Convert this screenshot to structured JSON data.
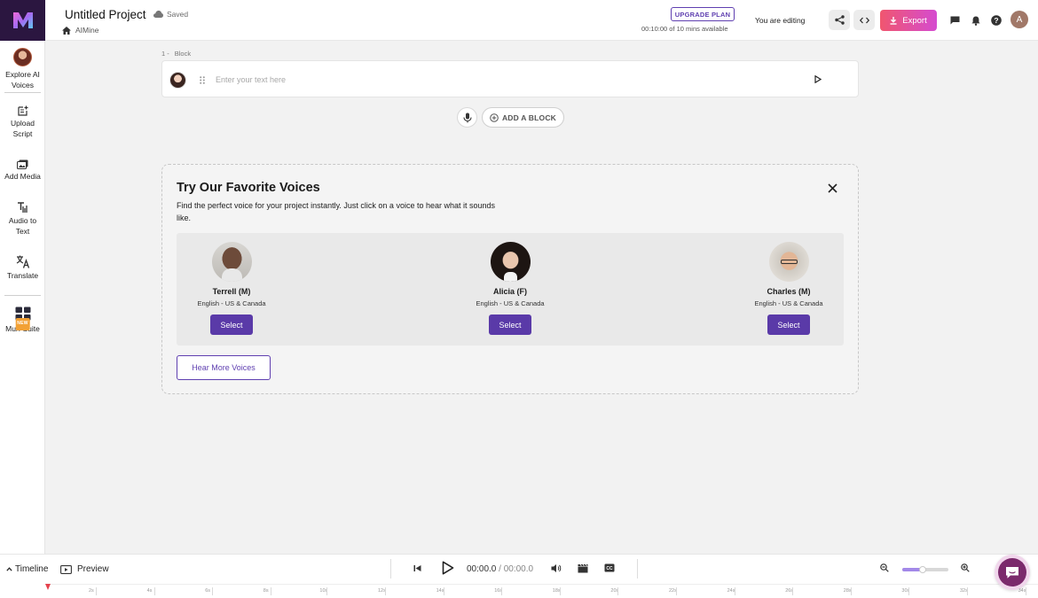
{
  "topbar": {
    "project_title": "Untitled Project",
    "saved_label": "Saved",
    "breadcrumb": "AIMine",
    "upgrade_label": "UPGRADE PLAN",
    "usage_text": "00:10:00 of 10 mins available",
    "editing_text": "You are editing",
    "export_label": "Export",
    "user_initial": "A"
  },
  "sidebar": {
    "items": [
      {
        "label_line1": "Explore AI",
        "label_line2": "Voices"
      },
      {
        "label_line1": "Upload",
        "label_line2": "Script"
      },
      {
        "label_line1": "Add Media",
        "label_line2": ""
      },
      {
        "label_line1": "Audio to",
        "label_line2": "Text"
      },
      {
        "label_line1": "Translate",
        "label_line2": ""
      },
      {
        "label_line1": "Murf Suite",
        "label_line2": "",
        "badge": "NEW"
      }
    ]
  },
  "editor": {
    "block_number": "1 -",
    "block_label": "Block",
    "block_placeholder": "Enter your text here",
    "add_block_label": "ADD A BLOCK"
  },
  "favorites": {
    "title": "Try Our Favorite Voices",
    "description": "Find the perfect voice for your project instantly. Just click on a voice to hear what it sounds like.",
    "voices": [
      {
        "name": "Terrell (M)",
        "language": "English - US & Canada",
        "select_label": "Select"
      },
      {
        "name": "Alicia (F)",
        "language": "English - US & Canada",
        "select_label": "Select"
      },
      {
        "name": "Charles (M)",
        "language": "English - US & Canada",
        "select_label": "Select"
      }
    ],
    "hear_more_label": "Hear More Voices"
  },
  "bottombar": {
    "timeline_label": "Timeline",
    "preview_label": "Preview",
    "current_time": "00:00.0",
    "separator": "/",
    "total_time": "00:00.0",
    "zoom_level": 0.45,
    "ruler_ticks": [
      "2s",
      "4s",
      "6s",
      "8s",
      "10s",
      "12s",
      "14s",
      "16s",
      "18s",
      "20s",
      "22s",
      "24s",
      "26s",
      "28s",
      "30s",
      "32s",
      "34s"
    ]
  },
  "colors": {
    "accent": "#5a3aa8",
    "export_gradient_start": "#f0566f",
    "export_gradient_end": "#d54bd0",
    "logo_bg": "#2b1640"
  }
}
